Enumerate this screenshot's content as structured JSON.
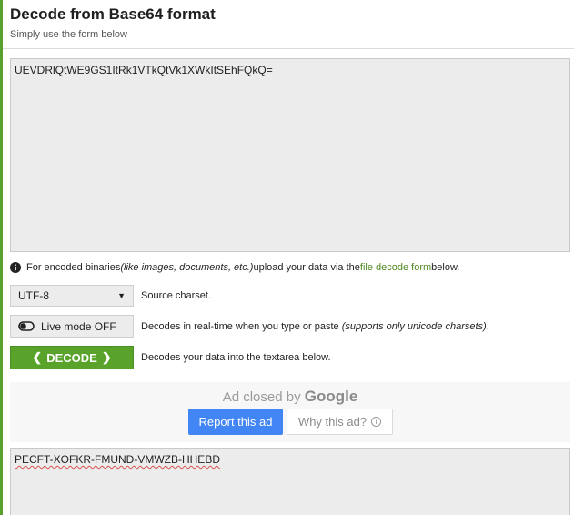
{
  "header": {
    "title": "Decode from Base64 format",
    "subtitle": "Simply use the form below"
  },
  "input": {
    "value": "UEVDRlQtWE9GS1ItRk1VTkQtVk1XWkItSEhFQkQ="
  },
  "info": {
    "prefix": "For encoded binaries ",
    "italic": "(like images, documents, etc.)",
    "middle": " upload your data via the ",
    "link": "file decode form",
    "suffix": " below."
  },
  "charset": {
    "selected": "UTF-8",
    "label": "Source charset."
  },
  "live_mode": {
    "button": "Live mode OFF",
    "desc": "Decodes in real-time when you type or paste ",
    "desc_italic": "(supports only unicode charsets)",
    "desc_end": "."
  },
  "decode": {
    "button": "DECODE",
    "desc": "Decodes your data into the textarea below."
  },
  "ad": {
    "closed_by": "Ad closed by ",
    "brand": "Google",
    "report": "Report this ad",
    "why": "Why this ad?"
  },
  "output": {
    "value": "PECFT-XOFKR-FMUND-VMWZB-HHEBD"
  },
  "colors": {
    "accent_green": "#59a32a",
    "link_green": "#4f8a22",
    "google_blue": "#4285f4"
  },
  "icons": {
    "info": "info-icon",
    "toggle": "toggle-icon",
    "dropdown": "chevron-down-icon",
    "question": "question-icon"
  }
}
